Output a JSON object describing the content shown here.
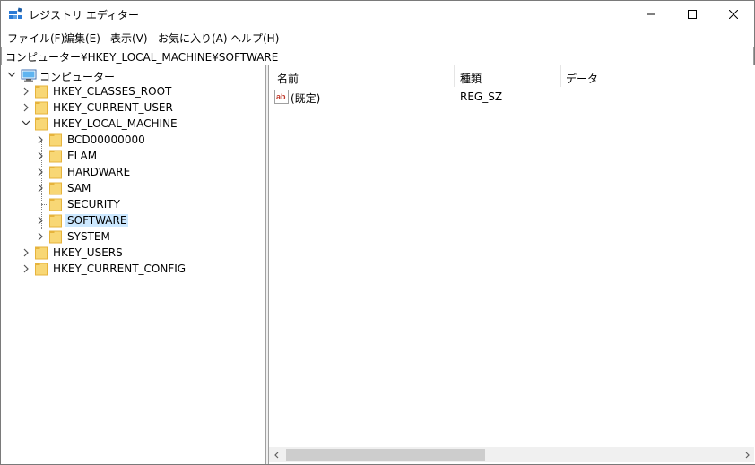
{
  "window": {
    "title": "レジストリ エディター",
    "icon": "registry-editor-icon"
  },
  "menu": [
    {
      "label": "ファイル(F)"
    },
    {
      "label": "編集(E)"
    },
    {
      "label": "表示(V)"
    },
    {
      "label": "お気に入り(A)"
    },
    {
      "label": "ヘルプ(H)"
    }
  ],
  "address": {
    "value": "コンピューター¥HKEY_LOCAL_MACHINE¥SOFTWARE"
  },
  "tree": {
    "root": {
      "label": "コンピューター",
      "icon": "computer-icon"
    },
    "items": [
      {
        "label": "HKEY_CLASSES_ROOT",
        "level": 1,
        "expanded": false
      },
      {
        "label": "HKEY_CURRENT_USER",
        "level": 1,
        "expanded": false
      },
      {
        "label": "HKEY_LOCAL_MACHINE",
        "level": 1,
        "expanded": true
      },
      {
        "label": "BCD00000000",
        "level": 2,
        "expanded": false
      },
      {
        "label": "ELAM",
        "level": 2,
        "expanded": false
      },
      {
        "label": "HARDWARE",
        "level": 2,
        "expanded": false
      },
      {
        "label": "SAM",
        "level": 2,
        "expanded": false
      },
      {
        "label": "SECURITY",
        "level": 2,
        "leaf": true
      },
      {
        "label": "SOFTWARE",
        "level": 2,
        "expanded": false,
        "selected": true
      },
      {
        "label": "SYSTEM",
        "level": 2,
        "expanded": false
      },
      {
        "label": "HKEY_USERS",
        "level": 1,
        "expanded": false
      },
      {
        "label": "HKEY_CURRENT_CONFIG",
        "level": 1,
        "expanded": false
      }
    ]
  },
  "list": {
    "columns": [
      "名前",
      "種類",
      "データ"
    ],
    "rows": [
      {
        "name": "(既定)",
        "type": "REG_SZ",
        "data": "",
        "icon": "string-value-icon"
      }
    ]
  },
  "colors": {
    "selection": "#cce8ff",
    "folder": "#f8d775",
    "folder_dark": "#e6b33c"
  }
}
